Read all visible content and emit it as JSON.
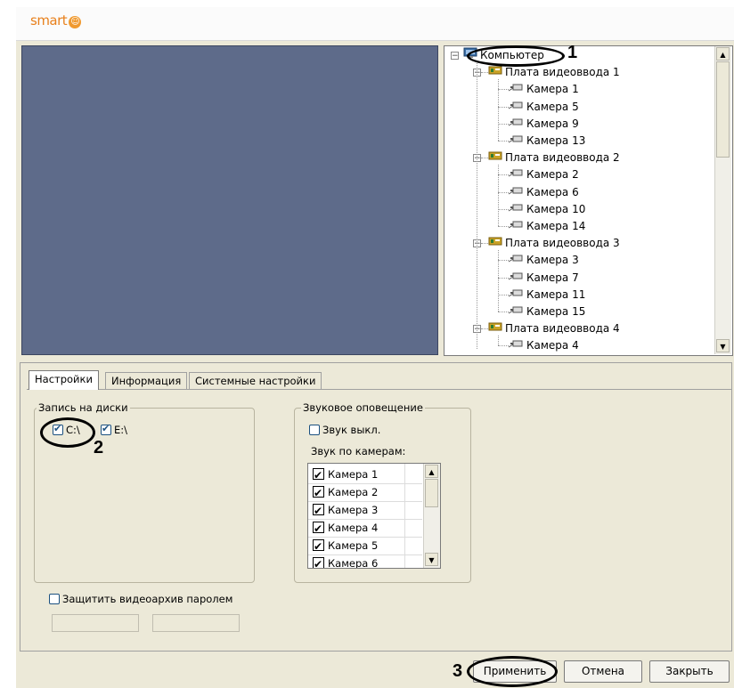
{
  "app": {
    "logo_text": "smart"
  },
  "tree": {
    "root": "Компьютер",
    "boards": [
      {
        "label": "Плата видеоввода 1",
        "cameras": [
          "Камера 1",
          "Камера 5",
          "Камера 9",
          "Камера 13"
        ]
      },
      {
        "label": "Плата видеоввода 2",
        "cameras": [
          "Камера 2",
          "Камера 6",
          "Камера 10",
          "Камера 14"
        ]
      },
      {
        "label": "Плата видеоввода 3",
        "cameras": [
          "Камера 3",
          "Камера 7",
          "Камера 11",
          "Камера 15"
        ]
      },
      {
        "label": "Плата видеоввода 4",
        "cameras": [
          "Камера 4"
        ]
      }
    ]
  },
  "tabs": [
    "Настройки",
    "Информация",
    "Системные настройки"
  ],
  "disks": {
    "group_label": "Запись на диски",
    "items": [
      {
        "label": "C:\\",
        "checked": true
      },
      {
        "label": "E:\\",
        "checked": true
      }
    ]
  },
  "sound": {
    "group_label": "Звуковое оповещение",
    "mute_label": "Звук выкл.",
    "mute_checked": false,
    "per_camera_label": "Звук по камерам:",
    "cameras": [
      "Камера 1",
      "Камера 2",
      "Камера 3",
      "Камера 4",
      "Камера 5",
      "Камера 6"
    ]
  },
  "protect": {
    "label": "Защитить видеоархив паролем",
    "checked": false
  },
  "buttons": {
    "apply": "Применить",
    "cancel": "Отмена",
    "close": "Закрыть"
  },
  "markers": [
    "1",
    "2",
    "3"
  ]
}
